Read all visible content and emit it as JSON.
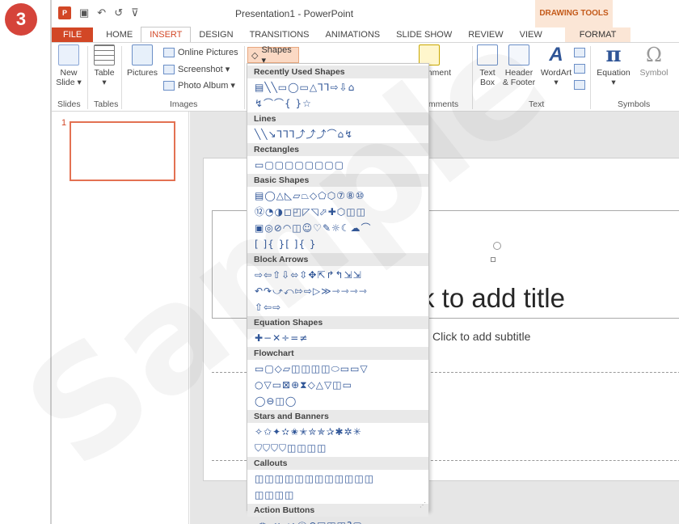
{
  "step_badge": "3",
  "watermark": "Sample",
  "window": {
    "title": "Presentation1 - PowerPoint",
    "context_title": "DRAWING TOOLS"
  },
  "qat": [
    "↶",
    "↺",
    "⊽"
  ],
  "tabs": [
    "FILE",
    "HOME",
    "INSERT",
    "DESIGN",
    "TRANSITIONS",
    "ANIMATIONS",
    "SLIDE SHOW",
    "REVIEW",
    "VIEW",
    "FORMAT"
  ],
  "ribbon": {
    "new_slide_1": "New",
    "new_slide_2": "Slide ▾",
    "table": "Table",
    "table_arrow": "▾",
    "pictures": "Pictures",
    "online_pictures": "Online Pictures",
    "screenshot": "Screenshot ▾",
    "photo_album": "Photo Album ▾",
    "shapes": "Shapes ▾",
    "comment": "omment",
    "text_box_1": "Text",
    "text_box_2": "Box",
    "header_footer_1": "Header",
    "header_footer_2": "& Footer",
    "wordart": "WordArt",
    "wordart_arrow": "▾",
    "equation": "Equation",
    "equation_arrow": "▾",
    "symbol": "Symbol",
    "groups": {
      "slides": "Slides",
      "tables": "Tables",
      "images": "Images",
      "comments": "omments",
      "text": "Text",
      "symbols": "Symbols"
    }
  },
  "slides_pane": {
    "slide_number": "1"
  },
  "slide": {
    "title_placeholder": "k to add title",
    "subtitle_placeholder": "Click to add subtitle"
  },
  "shapes_menu": {
    "sections": [
      {
        "title": "Recently Used Shapes",
        "rows": [
          "▤╲╲▭◯▭△⅂⅂⇨⇩⌂",
          "↯⌒⌒{ }☆"
        ]
      },
      {
        "title": "Lines",
        "rows": [
          "╲╲↘⅂⅂⅂⤴⤴⤴⌒⌂↯"
        ]
      },
      {
        "title": "Rectangles",
        "rows": [
          "▭▢▢▢▢▢▢▢▢"
        ]
      },
      {
        "title": "Basic Shapes",
        "rows": [
          "▤◯△◺▱⏢◇⬠⬡⑦⑧⑩",
          "⑫◔◑◻◰◸◹⬀✚⬡◫◫",
          "▣◎⊘◠◫☺♡✎☼☾☁⌒",
          "[ ]{ }[ ]{ }"
        ]
      },
      {
        "title": "Block Arrows",
        "rows": [
          "⇨⇦⇧⇩⬄⇳✥⇱↱↰⇲⇲",
          "↶↷⤻⤺⇰⇨▷≫⇾⇾⇾⇾",
          "⇧⇦⇨"
        ]
      },
      {
        "title": "Equation Shapes",
        "rows": [
          "✚−✕÷=≠"
        ]
      },
      {
        "title": "Flowchart",
        "rows": [
          "▭▢◇▱◫◫◫◫⬭▭▭▽",
          "○▽▭⊠⊕⧗◇△▽◫▭",
          "◯⊖◫◯"
        ]
      },
      {
        "title": "Stars and Banners",
        "rows": [
          "✧✩✦✫✬✭✮✯✰✱✲✳",
          "⛉⛉⛉⛉◫◫◫◫"
        ]
      },
      {
        "title": "Callouts",
        "rows": [
          "◫◫◫◫◫◫◫◫◫◫◫◫",
          "◫◫◫◫"
        ]
      },
      {
        "title": "Action Buttons",
        "rows": [
          "◁▷⏮⏭⌂ⓘ↶▣◫◫?▢"
        ]
      }
    ]
  }
}
